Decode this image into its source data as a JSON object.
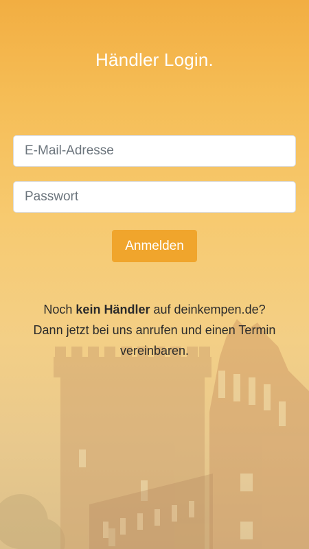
{
  "header": {
    "title": "Händler Login."
  },
  "form": {
    "email_placeholder": "E-Mail-Adresse",
    "password_placeholder": "Passwort",
    "submit_label": "Anmelden"
  },
  "notice": {
    "prefix": "Noch ",
    "bold": "kein Händler",
    "middle": " auf deinkempen.de?",
    "line2": "Dann jetzt bei uns anrufen und einen Termin vereinbaren."
  },
  "colors": {
    "accent": "#f0a52c",
    "background_top": "#f2ae42",
    "text": "#2b2b2b"
  },
  "background": {
    "icon": "castle-tower-background"
  }
}
